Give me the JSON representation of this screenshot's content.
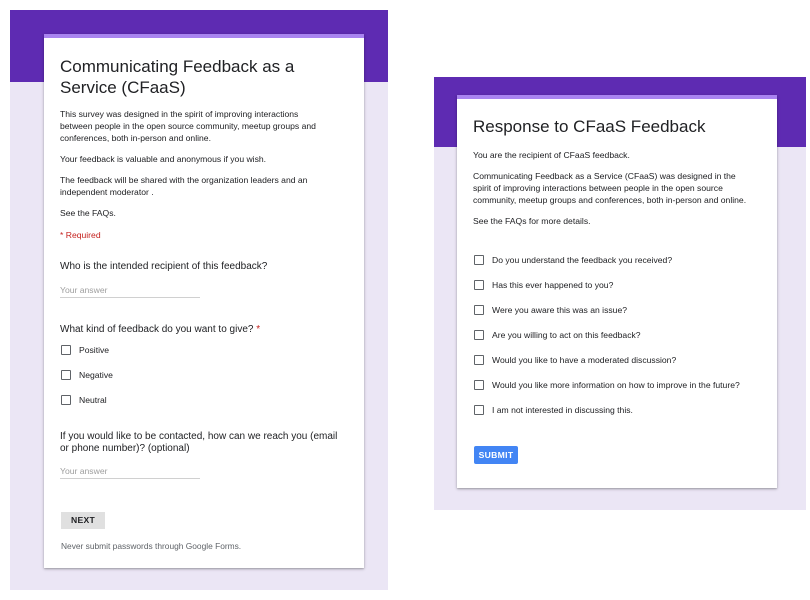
{
  "colors": {
    "band": "#5e2bb2",
    "background": "#ebe6f5",
    "accent": "#a984f0",
    "required": "#c5221f",
    "submit_button": "#4285f4"
  },
  "left_form": {
    "title_line1": "Communicating Feedback as a",
    "title_line2": "Service (CFaaS)",
    "description": [
      "This survey was designed in the spirit of improving interactions",
      "between people in the open source community, meetup groups and",
      "conferences, both in-person and online."
    ],
    "anonymous_note": "Your feedback is valuable and anonymous if you wish.",
    "shared_note": [
      "The feedback will be shared with the organization leaders and an",
      "independent moderator ."
    ],
    "faq_note": "See the FAQs.",
    "required_label": "* Required",
    "q1": {
      "label": "Who is the intended recipient of this feedback?",
      "placeholder": "Your answer"
    },
    "q2": {
      "label": "What kind of feedback do you want to give?",
      "required_marker": "*",
      "options": [
        "Positive",
        "Negative",
        "Neutral"
      ]
    },
    "q3": {
      "label_line1": "If you would like to be contacted, how can we reach you (email",
      "label_line2": "or phone number)? (optional)",
      "placeholder": "Your answer"
    },
    "next_button": "NEXT",
    "footer": "Never submit passwords through Google Forms."
  },
  "right_form": {
    "title": "Response to CFaaS Feedback",
    "recipient_note": "You are the recipient of CFaaS feedback.",
    "description": [
      "Communicating Feedback as a Service (CFaaS) was designed in the",
      "spirit of improving interactions between people in the open source",
      "community, meetup groups and conferences, both in-person and online."
    ],
    "faq_note": "See the FAQs for more details.",
    "options": [
      "Do you understand the feedback you received?",
      "Has this ever happened to you?",
      "Were you aware this was an issue?",
      "Are you willing to act on this feedback?",
      "Would you like to have a moderated discussion?",
      "Would you like more information on how to improve in the future?",
      "I am not interested in discussing this."
    ],
    "submit_button": "SUBMIT"
  }
}
